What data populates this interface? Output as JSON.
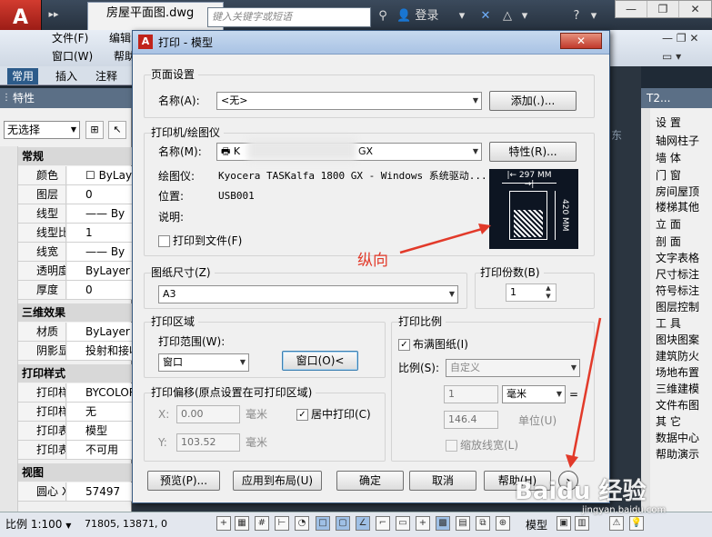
{
  "app": {
    "doc_tab": "房屋平面图.dwg",
    "search_placeholder": "键入关键字或短语",
    "login": "登录",
    "menu": [
      "文件(F)",
      "编辑",
      "窗口(W)",
      "帮助"
    ],
    "ribbon_tabs": [
      "常用",
      "插入",
      "注释"
    ]
  },
  "props": {
    "title": "特性",
    "selection": "无选择",
    "sections": [
      {
        "title": "常规",
        "rows": [
          {
            "k": "颜色",
            "v": "ByLayer"
          },
          {
            "k": "图层",
            "v": "0"
          },
          {
            "k": "线型",
            "v": "—— By"
          },
          {
            "k": "线型比例",
            "v": "1"
          },
          {
            "k": "线宽",
            "v": "—— By"
          },
          {
            "k": "透明度",
            "v": "ByLayer"
          },
          {
            "k": "厚度",
            "v": "0"
          }
        ]
      },
      {
        "title": "三维效果",
        "rows": [
          {
            "k": "材质",
            "v": "ByLayer"
          },
          {
            "k": "阴影显示",
            "v": "投射和接收"
          }
        ]
      },
      {
        "title": "打印样式",
        "rows": [
          {
            "k": "打印样式",
            "v": "BYCOLOR"
          },
          {
            "k": "打印样...",
            "v": "无"
          },
          {
            "k": "打印表...",
            "v": "模型"
          },
          {
            "k": "打印表...",
            "v": "不可用"
          }
        ]
      },
      {
        "title": "视图",
        "rows": [
          {
            "k": "圆心 X ...",
            "v": "57497"
          }
        ]
      }
    ]
  },
  "right_panel": {
    "title": "T2...",
    "items": [
      "设 置",
      "轴网柱子",
      "墙 体",
      "门 窗",
      "房间屋顶",
      "楼梯其他",
      "立 面",
      "剖 面",
      "文字表格",
      "尺寸标注",
      "符号标注",
      "图层控制",
      "工 具",
      "图块图案",
      "建筑防火",
      "场地布置",
      "三维建模",
      "文件布图",
      "其 它",
      "数据中心",
      "帮助演示"
    ]
  },
  "dialog": {
    "title": "打印 - 模型",
    "page_setup": {
      "group": "页面设置",
      "name_label": "名称(A):",
      "name_value": "<无>",
      "add_button": "添加(.)..."
    },
    "printer": {
      "group": "打印机/绘图仪",
      "name_label": "名称(M):",
      "name_value_left": "K",
      "name_value_right": "GX",
      "properties_button": "特性(R)...",
      "plotter_label": "绘图仪:",
      "plotter_value": "Kyocera TASKalfa 1800 GX - Windows 系统驱动...",
      "location_label": "位置:",
      "location_value": "USB001",
      "desc_label": "说明:",
      "print_to_file": "打印到文件(F)",
      "paper_width": "297 MM",
      "paper_height": "420 MM"
    },
    "paper_size": {
      "group": "图纸尺寸(Z)",
      "value": "A3"
    },
    "copies": {
      "group": "打印份数(B)",
      "value": "1"
    },
    "plot_area": {
      "group": "打印区域",
      "range_label": "打印范围(W):",
      "range_value": "窗口",
      "window_button": "窗口(O)<"
    },
    "plot_offset": {
      "group": "打印偏移(原点设置在可打印区域)",
      "x_label": "X:",
      "x_value": "0.00",
      "x_unit": "毫米",
      "y_label": "Y:",
      "y_value": "103.52",
      "y_unit": "毫米",
      "center": "居中打印(C)"
    },
    "plot_scale": {
      "group": "打印比例",
      "fit": "布满图纸(I)",
      "scale_label": "比例(S):",
      "scale_value": "自定义",
      "v1": "1",
      "unit_value": "毫米",
      "eq": "=",
      "v2": "146.4",
      "unit_label": "单位(U)",
      "lineweights": "缩放线宽(L)"
    },
    "buttons": {
      "preview": "预览(P)...",
      "apply": "应用到布局(U)",
      "ok": "确定",
      "cancel": "取消",
      "help": "帮助(H)"
    }
  },
  "annotation": "纵向",
  "status": {
    "scale": "比例 1:100",
    "coords": "71805, 13871, 0",
    "model": "模型"
  },
  "watermark": "Baidu 经验",
  "watermark_url": "jingyan.baidu.com"
}
